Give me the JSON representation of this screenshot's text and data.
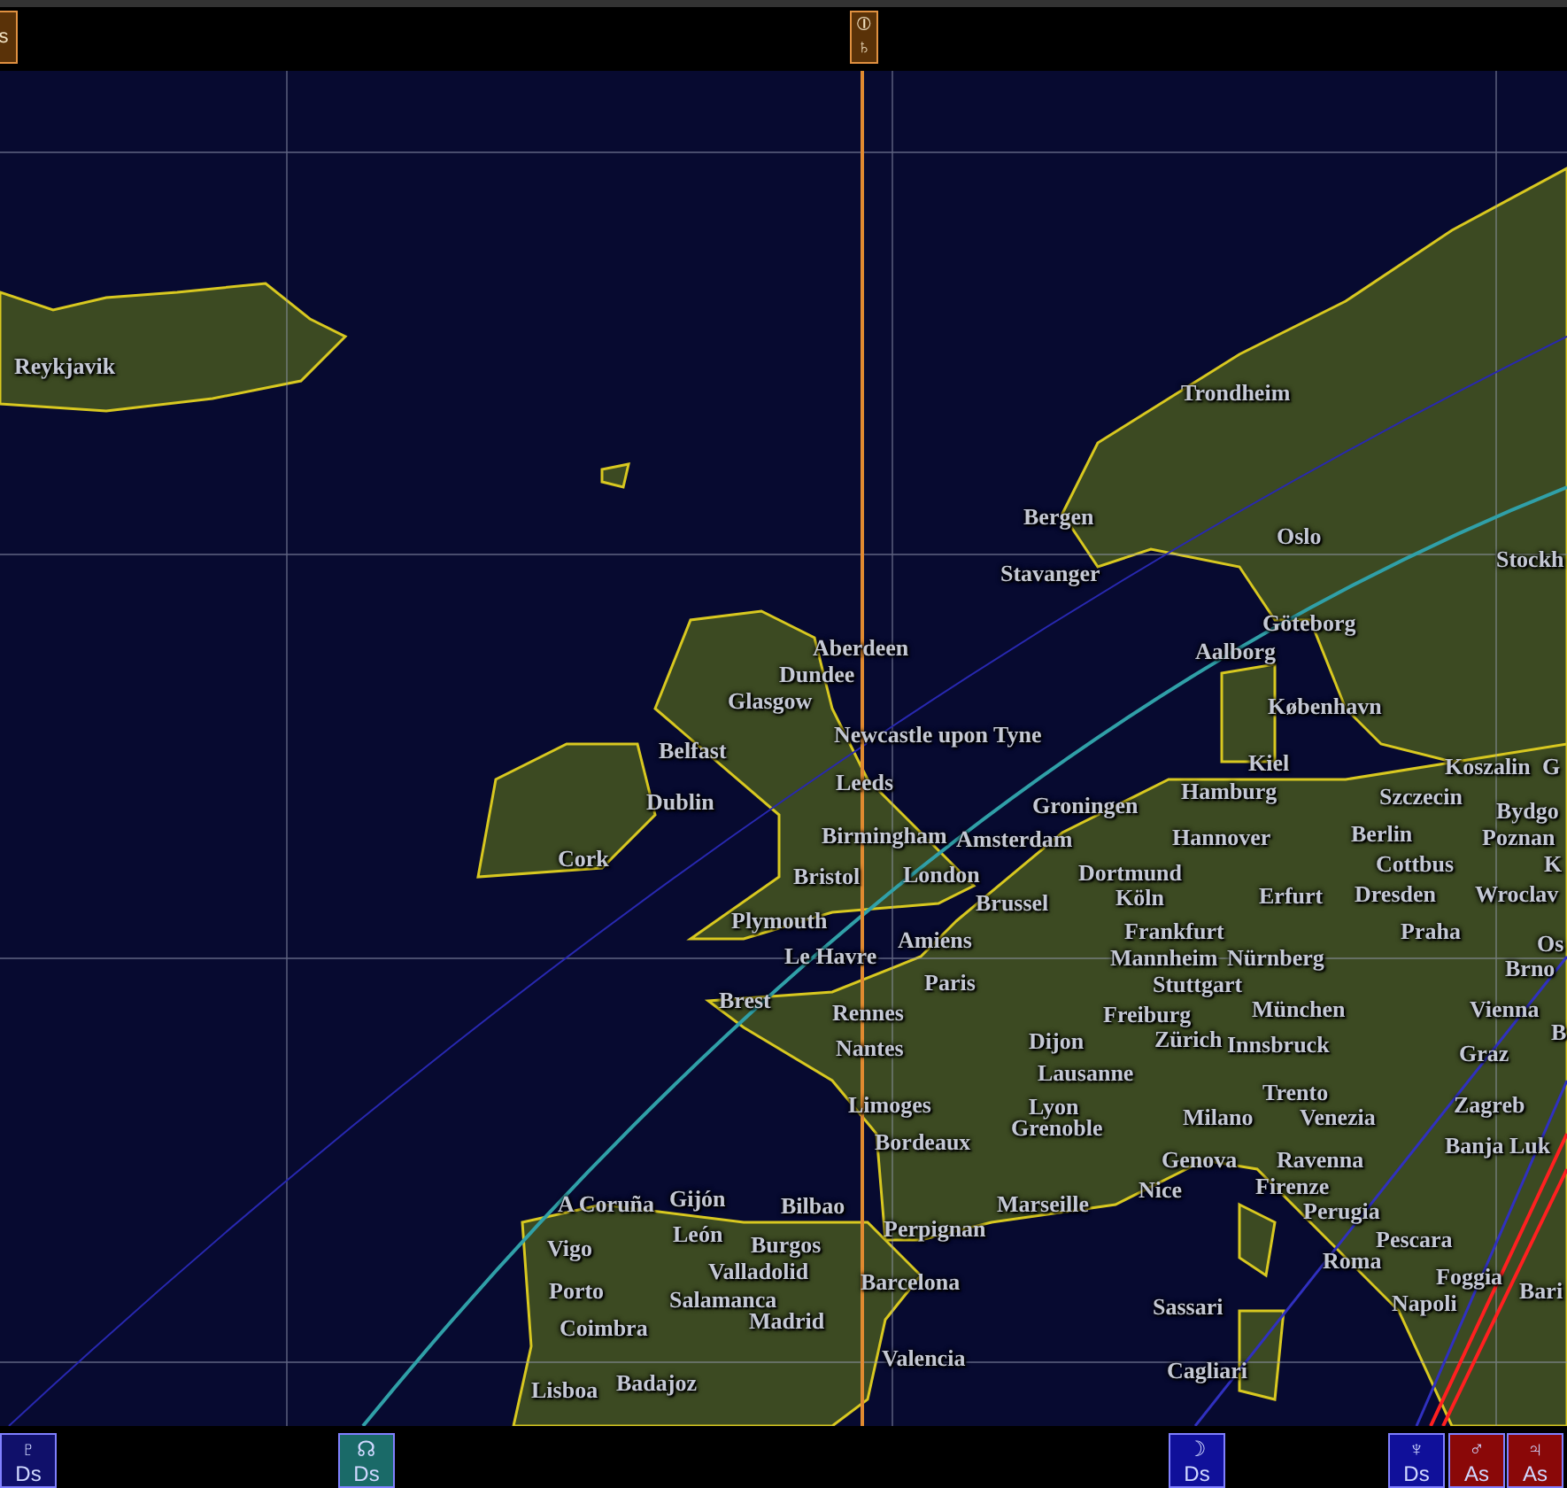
{
  "top_markers": [
    {
      "symbols": [
        "s"
      ]
    },
    {
      "symbols": [
        "⦶",
        "♄"
      ]
    }
  ],
  "cities": [
    "Reykjavik",
    "Trondheim",
    "Bergen",
    "Oslo",
    "Stavanger",
    "Stockh",
    "Göteborg",
    "Aalborg",
    "Aberdeen",
    "Dundee",
    "Glasgow",
    "København",
    "Newcastle upon Tyne",
    "Belfast",
    "Kiel",
    "Koszalin",
    "G",
    "Leeds",
    "Groningen",
    "Hamburg",
    "Szczecin",
    "Bydgo",
    "Dublin",
    "Birmingham",
    "Amsterdam",
    "Hannover",
    "Berlin",
    "Poznan",
    "Cork",
    "Bristol",
    "London",
    "Cottbus",
    "K",
    "Dortmund",
    "Brussel",
    "Köln",
    "Erfurt",
    "Dresden",
    "Wroclav",
    "Plymouth",
    "Amiens",
    "Frankfurt",
    "Praha",
    "Os",
    "Le Havre",
    "Mannheim",
    "Nürnberg",
    "Paris",
    "Stuttgart",
    "Brno",
    "Brest",
    "Rennes",
    "Freiburg",
    "München",
    "Vienna",
    "B",
    "Nantes",
    "Dijon",
    "Zürich",
    "Innsbruck",
    "Graz",
    "Lausanne",
    "Limoges",
    "Lyon",
    "Trento",
    "Grenoble",
    "Milano",
    "Venezia",
    "Zagreb",
    "Bordeaux",
    "Genova",
    "Ravenna",
    "Banja Luk",
    "A Coruña",
    "Gijón",
    "Bilbao",
    "Marseille",
    "Nice",
    "Firenze",
    "León",
    "Burgos",
    "Perpignan",
    "Perugia",
    "Pescara",
    "Vigo",
    "Valladolid",
    "Roma",
    "Sassari",
    "Porto",
    "Barcelona",
    "Salamanca",
    "Foggia",
    "Bari",
    "Napoli",
    "Madrid",
    "Coimbra",
    "Cagliari",
    "Valencia",
    "Lisboa",
    "Badajoz"
  ],
  "bottom_markers": [
    {
      "symbol": "♇",
      "label": "Ds",
      "color": "#10106a"
    },
    {
      "symbol": "☊",
      "label": "Ds",
      "color": "#1a6a68"
    },
    {
      "symbol": "☽",
      "label": "Ds",
      "color": "#10109a"
    },
    {
      "symbol": "♆",
      "label": "Ds",
      "color": "#10109a"
    },
    {
      "symbol": "♂",
      "label": "As",
      "color": "#8a0808"
    },
    {
      "symbol": "♃",
      "label": "As",
      "color": "#8a0808"
    }
  ]
}
